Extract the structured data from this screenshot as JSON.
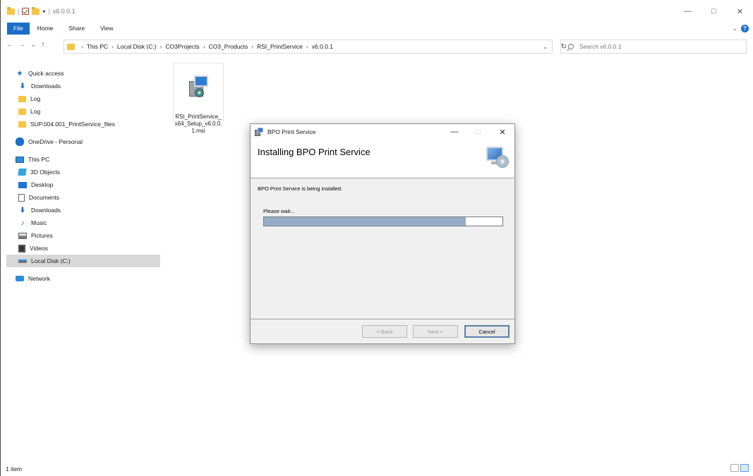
{
  "window": {
    "title": "v6.0.0.1",
    "controls": {
      "minimize": "—",
      "maximize": "□",
      "close": "✕"
    }
  },
  "ribbon": {
    "tabs": [
      "File",
      "Home",
      "Share",
      "View"
    ]
  },
  "address": {
    "crumbs": [
      "This PC",
      "Local Disk (C:)",
      "CO3Projects",
      "CO3_Products",
      "RSI_PrintService",
      "v6.0.0.1"
    ],
    "search_placeholder": "Search v6.0.0.1"
  },
  "sidebar": {
    "quick_access": {
      "label": "Quick access",
      "items": [
        "Downloads",
        "Log",
        "Log",
        "SUP.004.001_PrintService_files"
      ]
    },
    "onedrive": "OneDrive - Personal",
    "this_pc": {
      "label": "This PC",
      "items": [
        "3D Objects",
        "Desktop",
        "Documents",
        "Downloads",
        "Music",
        "Pictures",
        "Videos",
        "Local Disk (C:)"
      ]
    },
    "network": "Network"
  },
  "files": [
    {
      "name": "RSI_PrintService_\nx64_Setup_v6.0.0.\n1.msi",
      "icon": "msi-installer-icon"
    }
  ],
  "status": {
    "item_count": "1 item"
  },
  "dialog": {
    "title": "BPO Print Service",
    "heading": "Installing BPO Print Service",
    "message": "BPO Print Service is being installed.",
    "wait_label": "Please wait...",
    "progress_fraction": 0.845,
    "buttons": {
      "back": "< Back",
      "next": "Next >",
      "cancel": "Cancel"
    },
    "controls": {
      "minimize": "—",
      "maximize": "□",
      "close": "✕"
    }
  }
}
